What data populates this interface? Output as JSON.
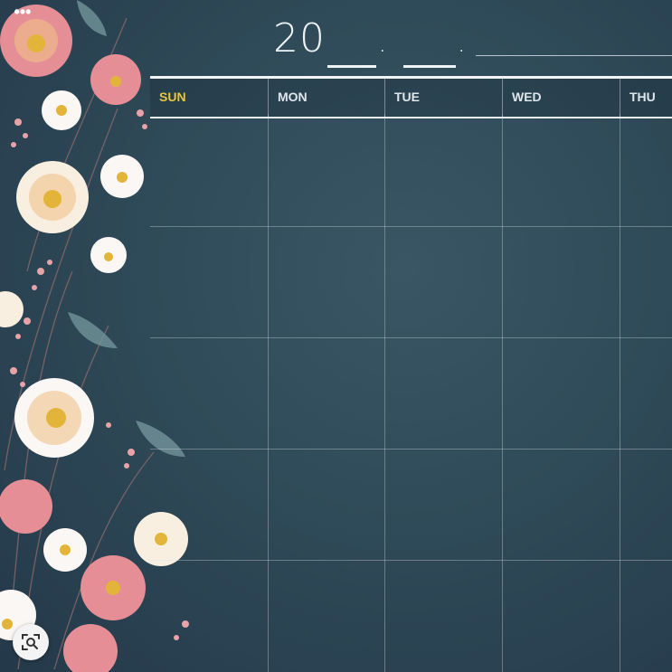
{
  "title": {
    "year_prefix": "20",
    "dot1": ".",
    "dot2": "."
  },
  "calendar": {
    "weekdays": [
      "SUN",
      "MON",
      "TUE",
      "WED",
      "THU"
    ]
  },
  "toolbar": {
    "more_label": "•••",
    "more_icon": "more-dots-icon",
    "lens_icon": "visual-search-icon"
  },
  "colors": {
    "background": "#2f4a58",
    "sunday_accent": "#e7c63a",
    "text": "#eef3f6"
  }
}
